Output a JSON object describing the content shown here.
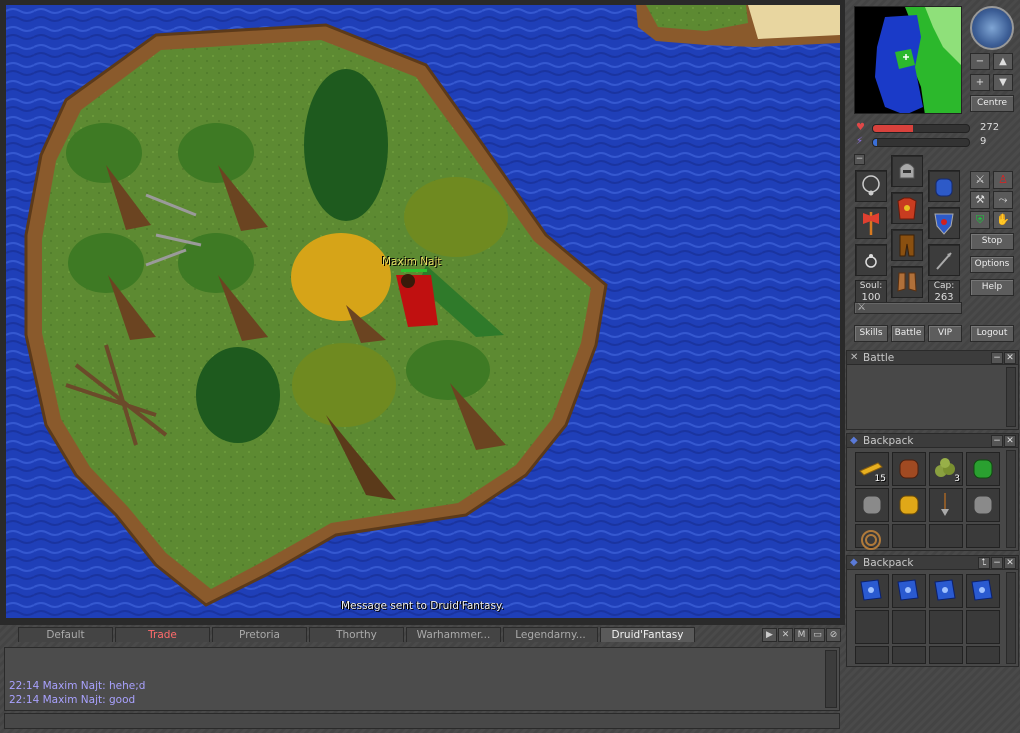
{
  "game": {
    "broadcast": "Message sent to Druid'Fantasy.",
    "player": {
      "name": "Maxim Najt",
      "health_fraction": 1.0
    }
  },
  "colors": {
    "water": "#1f3fb8",
    "grass": "#5d8a32",
    "chat_text": "#a9a2ff",
    "trade_tab": "#ff6b6b",
    "hp_bar": "#d8413c",
    "mana_bar": "#3a6fd8"
  },
  "chat": {
    "tabs": [
      {
        "label": "Default"
      },
      {
        "label": "Trade"
      },
      {
        "label": "Pretoria"
      },
      {
        "label": "Thorthy"
      },
      {
        "label": "Warhammer..."
      },
      {
        "label": "Legendarny..."
      },
      {
        "label": "Druid'Fantasy"
      }
    ],
    "active_tab": "Druid'Fantasy",
    "tools": [
      "▶",
      "✕",
      "M",
      "▭",
      "⊘"
    ],
    "messages": [
      {
        "text": "22:14 Maxim Najt: hehe;d"
      },
      {
        "text": "22:14 Maxim Najt: good"
      }
    ]
  },
  "side": {
    "minimap": {
      "centre_label": "Centre"
    },
    "stats": {
      "health": {
        "value": "272",
        "fraction": 0.42
      },
      "mana": {
        "value": "9",
        "fraction": 0.04
      }
    },
    "soul": {
      "label": "Soul:",
      "value": "100"
    },
    "cap": {
      "label": "Cap:",
      "value": "263"
    },
    "buttons": {
      "stop": "Stop",
      "options": "Options",
      "help": "Help",
      "skills": "Skills",
      "battle": "Battle",
      "vip": "VIP",
      "logout": "Logout"
    },
    "battle_window": {
      "title": "Battle"
    },
    "backpack1": {
      "title": "Backpack",
      "items": [
        {
          "icon": "gold-coins-icon",
          "count": "15"
        },
        {
          "icon": "brown-backpack-icon",
          "count": ""
        },
        {
          "icon": "herb-pile-icon",
          "count": "3"
        },
        {
          "icon": "green-backpack-icon",
          "count": ""
        },
        {
          "icon": "grey-backpack-icon",
          "count": ""
        },
        {
          "icon": "golden-backpack-icon",
          "count": ""
        },
        {
          "icon": "shovel-icon",
          "count": ""
        },
        {
          "icon": "grey-backpack-icon",
          "count": ""
        },
        {
          "icon": "rope-icon",
          "count": ""
        }
      ]
    },
    "backpack2": {
      "title": "Backpack",
      "items": [
        {
          "icon": "blue-rune-icon"
        },
        {
          "icon": "blue-rune-icon"
        },
        {
          "icon": "blue-rune-icon"
        },
        {
          "icon": "blue-rune-icon"
        }
      ]
    }
  }
}
